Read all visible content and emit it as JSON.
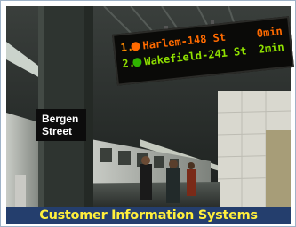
{
  "caption": "Customer Information Systems",
  "station_sign": {
    "line1": "Bergen",
    "line2": "Street"
  },
  "countdown_board": {
    "rows": [
      {
        "rank": "1.",
        "route": "2",
        "destination": "Harlem-148 St",
        "eta": "0min",
        "color": "#ff6a00"
      },
      {
        "rank": "2.",
        "route": "2",
        "destination": "Wakefield-241 St",
        "eta": "2min",
        "color": "#8fe000"
      }
    ]
  },
  "colors": {
    "caption_background": "#243e6d",
    "caption_text": "#ffef3c"
  }
}
